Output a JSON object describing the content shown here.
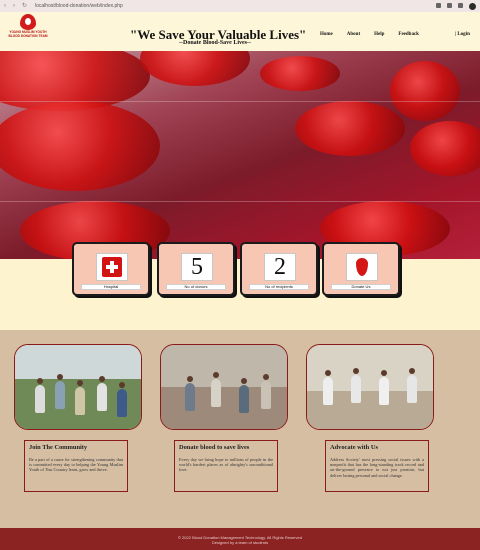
{
  "browser": {
    "url": "localhost/blood-donation/web/index.php"
  },
  "header": {
    "logo_text": "YOUNG MUSLIM YOUTH BLOOD DONATION TEAM",
    "title": "\"We Save Your Valuable Lives\"",
    "subtitle": "--Donate Blood-Save Lives--",
    "nav": [
      "Home",
      "About",
      "Help",
      "Feedback"
    ],
    "login": "| Login"
  },
  "stats": [
    {
      "caption": "Hospital",
      "icon": "hospital-icon"
    },
    {
      "caption": "No of donors",
      "value": "5"
    },
    {
      "caption": "No of recipients",
      "value": "2"
    },
    {
      "caption": "Donate Us",
      "icon": "blood-drop-icon"
    }
  ],
  "activities": [
    {
      "title": "Join The Community",
      "text": "Be a part of a cause for strengthening community that is committed every day to helping the Young Muslim Youth of Tisu Country learn, grow and thrive."
    },
    {
      "title": "Donate blood to save lives",
      "text": "Every day we bring hope to millions of people in the world's hardest places as of almighty's unconditional love."
    },
    {
      "title": "Advocate with Us",
      "text": "Address Society' most pressing social issues with a nonprofit that has the long-standing track record and on-the-ground presence to not just promise, but deliver lasting personal and social change."
    }
  ],
  "footer": {
    "line1": "© 2022 Blood Donation Management Technology. All Rights Reserved",
    "line2": "Designed by a team of students"
  },
  "colors": {
    "brand_red": "#8b2323",
    "accent_red": "#d11313",
    "cream": "#fdf6d9",
    "tan": "#d6bea3",
    "card": "#f7c7b4"
  }
}
